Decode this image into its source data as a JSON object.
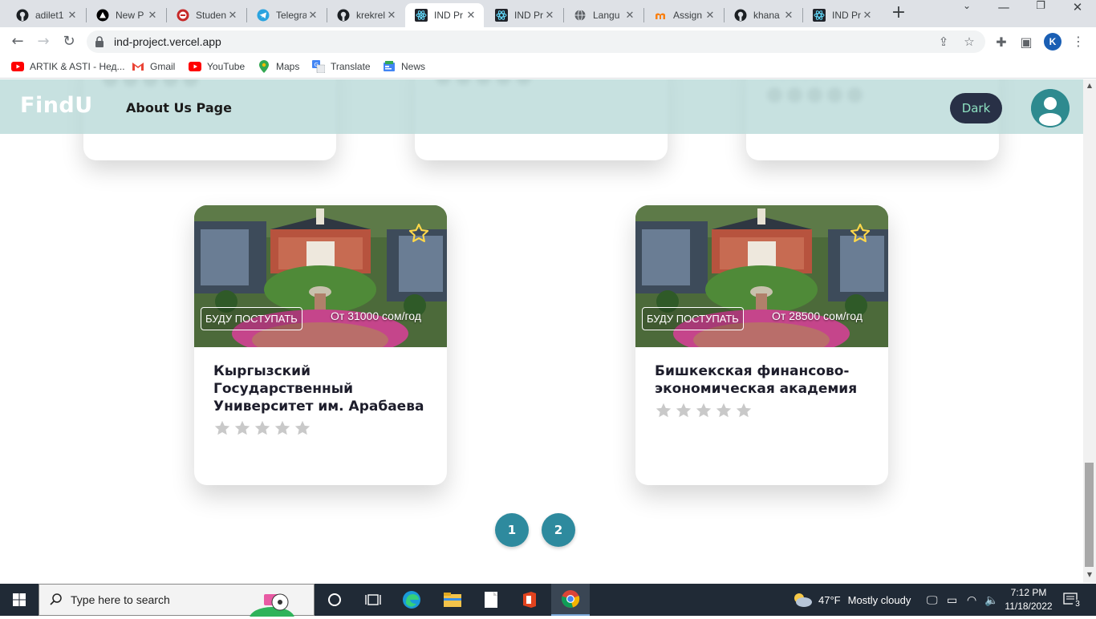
{
  "browser": {
    "tabs": [
      {
        "title": "adilet1",
        "icon": "github-icon"
      },
      {
        "title": "New P",
        "icon": "vercel-icon"
      },
      {
        "title": "Studen",
        "icon": "student-icon"
      },
      {
        "title": "Telegra",
        "icon": "telegram-icon"
      },
      {
        "title": "krekrel",
        "icon": "github-icon"
      },
      {
        "title": "IND Pr",
        "icon": "react-icon",
        "active": true
      },
      {
        "title": "IND Pr",
        "icon": "react-icon"
      },
      {
        "title": "Langu",
        "icon": "globe-icon"
      },
      {
        "title": "Assign",
        "icon": "moodle-icon"
      },
      {
        "title": "khana",
        "icon": "github-icon"
      },
      {
        "title": "IND Pr",
        "icon": "react-icon"
      }
    ],
    "url": "ind-project.vercel.app",
    "profile_initial": "K",
    "bookmarks": [
      {
        "label": "ARTIK & ASTI - Нед...",
        "icon": "youtube-icon"
      },
      {
        "label": "Gmail",
        "icon": "gmail-icon"
      },
      {
        "label": "YouTube",
        "icon": "youtube-icon"
      },
      {
        "label": "Maps",
        "icon": "maps-icon"
      },
      {
        "label": "Translate",
        "icon": "translate-icon"
      },
      {
        "label": "News",
        "icon": "news-icon"
      }
    ]
  },
  "header": {
    "logo": "FindU",
    "nav_link": "About Us Page",
    "theme_button": "Dark"
  },
  "cards": [
    {
      "badge": "БУДУ ПОСТУПАТЬ",
      "price": "От 31000 сом/год",
      "title": "Кыргызский Государственный Университет им. Арабаева",
      "rating": 0
    },
    {
      "badge": "БУДУ ПОСТУПАТЬ",
      "price": "От 28500 сом/год",
      "title": "Бишкекская финансово-экономическая академия",
      "rating": 0
    }
  ],
  "pagination": {
    "pages": [
      "1",
      "2"
    ]
  },
  "taskbar": {
    "search_placeholder": "Type here to search",
    "weather_temp": "47°F",
    "weather_text": "Mostly cloudy",
    "time": "7:12 PM",
    "date": "11/18/2022",
    "notifications": "3"
  },
  "colors": {
    "header_bg": "#b4d7d5",
    "accent": "#2e8a9e",
    "dark_button": "#283046"
  }
}
